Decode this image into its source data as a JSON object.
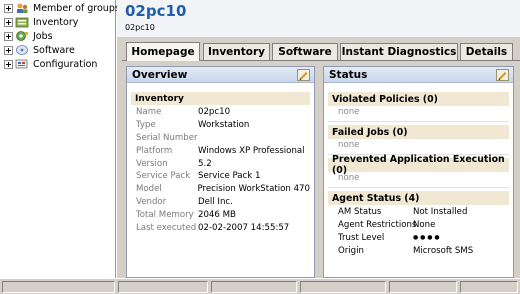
{
  "tree": {
    "items": [
      {
        "label": "Member of groups",
        "icon": "group-icon"
      },
      {
        "label": "Inventory",
        "icon": "inventory-icon"
      },
      {
        "label": "Jobs",
        "icon": "jobs-icon"
      },
      {
        "label": "Software",
        "icon": "software-icon"
      },
      {
        "label": "Configuration",
        "icon": "configuration-icon"
      }
    ]
  },
  "header": {
    "title": "02pc10",
    "subtitle": "02pc10"
  },
  "tabs": [
    {
      "label": "Homepage",
      "active": true
    },
    {
      "label": "Inventory",
      "active": false
    },
    {
      "label": "Software",
      "active": false
    },
    {
      "label": "Instant Diagnostics",
      "active": false
    },
    {
      "label": "Details",
      "active": false
    }
  ],
  "overview": {
    "title": "Overview",
    "section": "Inventory",
    "rows": [
      {
        "key": "Name",
        "value": "02pc10"
      },
      {
        "key": "Type",
        "value": "Workstation"
      },
      {
        "key": "Serial Number",
        "value": ""
      },
      {
        "key": "Platform",
        "value": "Windows XP Professional"
      },
      {
        "key": "Version",
        "value": "5.2"
      },
      {
        "key": "Service Pack",
        "value": "Service Pack 1"
      },
      {
        "key": "Model",
        "value": "Precision WorkStation 470"
      },
      {
        "key": "Vendor",
        "value": "Dell Inc."
      },
      {
        "key": "Total Memory",
        "value": "2046 MB"
      },
      {
        "key": "Last executed",
        "value": "02-02-2007 14:55:57"
      }
    ]
  },
  "status": {
    "title": "Status",
    "violated": {
      "label": "Violated Policies (0)",
      "none": "none"
    },
    "failed": {
      "label": "Failed Jobs (0)",
      "none": "none"
    },
    "prevented": {
      "label": "Prevented Application Execution (0)",
      "none": "none"
    },
    "agent": {
      "label": "Agent Status (4)",
      "rows": [
        {
          "key": "AM Status",
          "value": "Not Installed"
        },
        {
          "key": "Agent Restrictions",
          "value": "None"
        },
        {
          "key": "Trust Level",
          "value": "● ● ● ●"
        },
        {
          "key": "Origin",
          "value": "Microsoft SMS"
        }
      ]
    }
  },
  "colors": {
    "title_blue": "#1f5fa8",
    "section_bg": "#f1e8d4",
    "panel_head": "#c9d6ea"
  }
}
